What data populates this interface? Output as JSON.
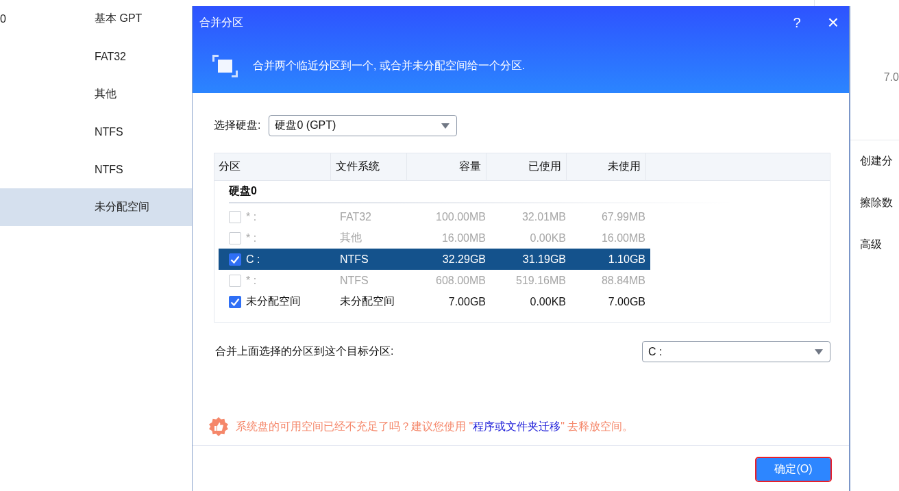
{
  "background": {
    "disk_list": [
      {
        "column_1": "0",
        "file_system": "基本 GPT",
        "selected": false
      },
      {
        "file_system": "FAT32",
        "selected": false
      },
      {
        "file_system": "其他",
        "selected": false
      },
      {
        "file_system": "NTFS",
        "selected": false
      },
      {
        "file_system": "NTFS",
        "selected": false
      },
      {
        "file_system": "未分配空间",
        "selected": true
      }
    ],
    "side_value": "7.0",
    "actions": [
      "创建分",
      "擦除数",
      "高级"
    ]
  },
  "dialog": {
    "title": "合并分区",
    "help": "?",
    "close": "×",
    "description": "合并两个临近分区到一个, 或合并未分配空间给一个分区.",
    "disk_label": "选择硬盘:",
    "disk_value": "硬盘0 (GPT)",
    "table": {
      "columns": [
        "分区",
        "文件系统",
        "容量",
        "已使用",
        "未使用"
      ],
      "group": "硬盘0",
      "rows": [
        {
          "partition": "* :",
          "file_system": "FAT32",
          "capacity": "100.00MB",
          "used": "32.01MB",
          "free": "67.99MB",
          "checked": false,
          "selected": false,
          "disabled": true
        },
        {
          "partition": "* :",
          "file_system": "其他",
          "capacity": "16.00MB",
          "used": "0.00KB",
          "free": "16.00MB",
          "checked": false,
          "selected": false,
          "disabled": true
        },
        {
          "partition": "C :",
          "file_system": "NTFS",
          "capacity": "32.29GB",
          "used": "31.19GB",
          "free": "1.10GB",
          "checked": true,
          "selected": true,
          "disabled": false
        },
        {
          "partition": "* :",
          "file_system": "NTFS",
          "capacity": "608.00MB",
          "used": "519.16MB",
          "free": "88.84MB",
          "checked": false,
          "selected": false,
          "disabled": true
        },
        {
          "partition": "未分配空间",
          "file_system": "未分配空间",
          "capacity": "7.00GB",
          "used": "0.00KB",
          "free": "7.00GB",
          "checked": true,
          "selected": false,
          "disabled": false
        }
      ]
    },
    "target_label": "合并上面选择的分区到这个目标分区:",
    "target_value": "C :",
    "tip": {
      "before": "系统盘的可用空间已经不充足了吗？建议您使用 \"",
      "link": "程序或文件夹迁移",
      "after": "\" 去释放空间。"
    },
    "ok_button": {
      "label": "确定(O)",
      "highlighted": true
    }
  }
}
